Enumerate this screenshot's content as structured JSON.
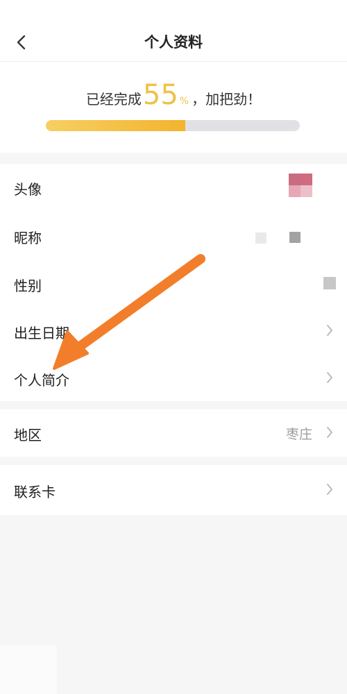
{
  "header": {
    "title": "个人资料",
    "back_icon": "chevron-left-icon"
  },
  "profile_completion": {
    "prefix": "已经完成",
    "value": "55",
    "unit": "%",
    "suffix": "，加把劲！",
    "progress_fraction": 0.55
  },
  "rows": [
    {
      "label": "头像",
      "value": ""
    },
    {
      "label": "昵称",
      "value": ""
    },
    {
      "label": "性别",
      "value": ""
    },
    {
      "label": "出生日期",
      "value": ""
    },
    {
      "label": "个人简介",
      "value": ""
    },
    {
      "label": "地区",
      "value": "枣庄"
    },
    {
      "label": "联系卡",
      "value": ""
    }
  ],
  "colors": {
    "accent": "#efc146",
    "progress_start": "#f6cf63",
    "progress_end": "#f3b42d",
    "annotation_arrow": "#f27e2b"
  },
  "icons": {
    "chevron": "chevron-right-icon",
    "annotation": "arrow-icon"
  }
}
